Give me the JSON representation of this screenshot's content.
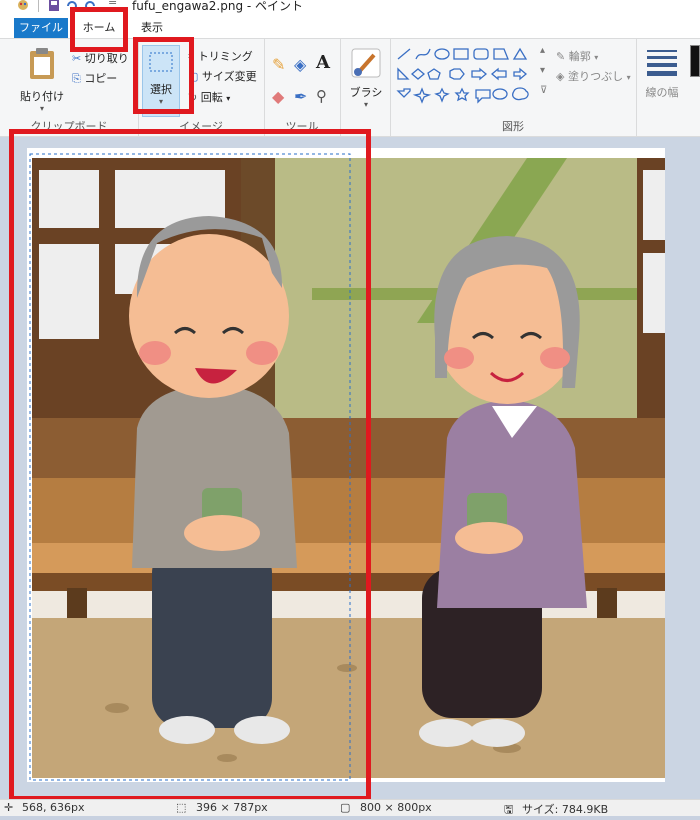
{
  "window": {
    "title": "fufu_engawa2.png - ペイント"
  },
  "tabs": {
    "file": "ファイル",
    "home": "ホーム",
    "view": "表示"
  },
  "clipboard": {
    "paste": "貼り付け",
    "cut": "切り取り",
    "copy": "コピー",
    "label": "クリップボード"
  },
  "image": {
    "select": "選択",
    "crop": "トリミング",
    "resize": "サイズ変更",
    "rotate": "回転",
    "label": "イメージ"
  },
  "tools": {
    "label": "ツール"
  },
  "brushes": {
    "label": "ブラシ"
  },
  "shapes": {
    "outline": "輪郭",
    "fill": "塗りつぶし",
    "label": "図形"
  },
  "size": {
    "label": "線の幅"
  },
  "status": {
    "cursor": "568, 636px",
    "selection": "396 × 787px",
    "image_size": "800 × 800px",
    "file_size": "サイズ: 784.9KB"
  },
  "colors": {
    "file_tab": "#1979ca",
    "highlight": "#e0191f",
    "ribbon": "#f5f6f7"
  }
}
